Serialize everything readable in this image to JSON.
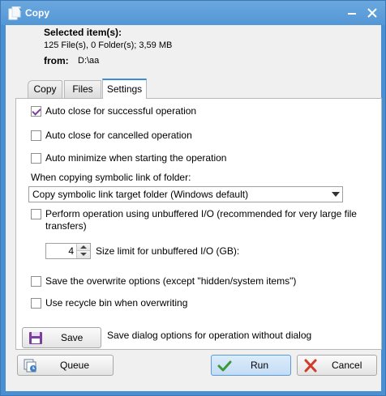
{
  "window": {
    "title": "Copy"
  },
  "selection": {
    "heading": "Selected item(s):",
    "info": "125 File(s), 0 Folder(s);   3,59 MB",
    "from_label": "from:",
    "from_path": "D:\\aa"
  },
  "tabs": [
    {
      "label": "Copy",
      "active": false
    },
    {
      "label": "Files",
      "active": false
    },
    {
      "label": "Settings",
      "active": true
    }
  ],
  "settings": {
    "auto_close_success": {
      "label": "Auto close for successful operation",
      "checked": true
    },
    "auto_close_cancelled": {
      "label": "Auto close for cancelled operation",
      "checked": false
    },
    "auto_minimize": {
      "label": "Auto minimize when starting the operation",
      "checked": false
    },
    "symlink_label": "When copying symbolic link of folder:",
    "symlink_option": "Copy symbolic link target folder (Windows default)",
    "unbuffered": {
      "label_line1": "Perform operation using unbuffered I/O (recommended for very large file",
      "label_line2": "transfers)",
      "checked": false
    },
    "size_limit": {
      "value": "4",
      "label": "Size limit for unbuffered I/O (GB):"
    },
    "save_overwrite": {
      "label": "Save the overwrite options (except \"hidden/system items\")",
      "checked": false
    },
    "recycle_bin": {
      "label": "Use recycle bin when overwriting",
      "checked": false
    },
    "save_button": "Save",
    "save_hint": "Save dialog options for operation without dialog"
  },
  "footer": {
    "queue": "Queue",
    "run": "Run",
    "cancel": "Cancel"
  },
  "icons": {
    "app": "copy-document-icon",
    "minimize": "minimize-icon",
    "close": "close-icon",
    "save": "floppy-disk-icon",
    "queue": "queue-icon",
    "run": "checkmark-icon",
    "cancel": "x-icon"
  },
  "colors": {
    "title_bar": "#5497d6",
    "checkmark": "#7a3f9e",
    "run_check": "#3a9a3a",
    "cancel_x": "#d23a2a",
    "save_floppy": "#7a3f9e"
  }
}
